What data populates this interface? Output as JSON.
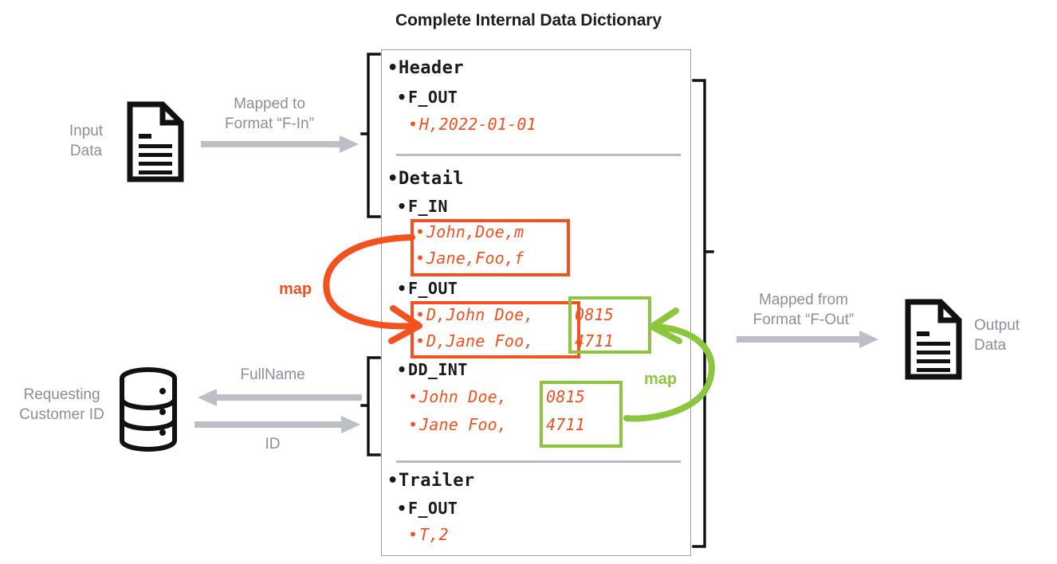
{
  "title": "Complete Internal Data Dictionary",
  "colors": {
    "orange": "#F4511E",
    "green": "#8CC63F",
    "gray": "#8c8f98",
    "arrow_gray": "#bdbfc7",
    "panel_border": "#9c9c9c",
    "divider": "#b9bcc6",
    "dark": "#1a1a1a"
  },
  "left": {
    "input_label_line1": "Input",
    "input_label_line2": "Data",
    "input_icon": "document-icon",
    "arrow_label_line1": "Mapped to",
    "arrow_label_line2": "Format “F-In”",
    "db_icon": "database-icon",
    "db_label_line1": "Requesting",
    "db_label_line2": "Customer ID",
    "fullname_arrow_label": "FullName",
    "id_arrow_label": "ID"
  },
  "right": {
    "arrow_label_line1": "Mapped from",
    "arrow_label_line2": "Format “F-Out”",
    "output_icon": "document-icon",
    "output_label_line1": "Output",
    "output_label_line2": "Data"
  },
  "annotations": {
    "map_left": "map",
    "map_right": "map"
  },
  "dictionary": {
    "sections": [
      {
        "name": "Header",
        "groups": [
          {
            "name": "F_OUT",
            "records": [
              "H,2022-01-01"
            ]
          }
        ]
      },
      {
        "name": "Detail",
        "groups": [
          {
            "name": "F_IN",
            "records": [
              "John,Doe,m",
              "Jane,Foo,f"
            ]
          },
          {
            "name": "F_OUT",
            "records": [
              "D,John Doe,0815",
              "D,Jane Foo,4711"
            ]
          },
          {
            "name": "DD_INT",
            "records": [
              "John Doe,0815",
              "Jane Foo,4711"
            ]
          }
        ]
      },
      {
        "name": "Trailer",
        "groups": [
          {
            "name": "F_OUT",
            "records": [
              "T,2"
            ]
          }
        ]
      }
    ]
  },
  "rows": {
    "header_title": "Header",
    "header_fout": "F_OUT",
    "header_fout_rec1": "H,2022-01-01",
    "detail_title": "Detail",
    "detail_fin": "F_IN",
    "detail_fin_rec1": "John,Doe,m",
    "detail_fin_rec2": "Jane,Foo,f",
    "detail_fout": "F_OUT",
    "detail_fout_rec1_left": "D,John Doe,",
    "detail_fout_rec1_right": "0815",
    "detail_fout_rec2_left": "D,Jane Foo,",
    "detail_fout_rec2_right": "4711",
    "detail_ddint": "DD_INT",
    "detail_ddint_rec1_left": "John Doe,",
    "detail_ddint_rec1_right": "0815",
    "detail_ddint_rec2_left": "Jane Foo,",
    "detail_ddint_rec2_right": "4711",
    "trailer_title": "Trailer",
    "trailer_fout": "F_OUT",
    "trailer_fout_rec1": "T,2"
  }
}
